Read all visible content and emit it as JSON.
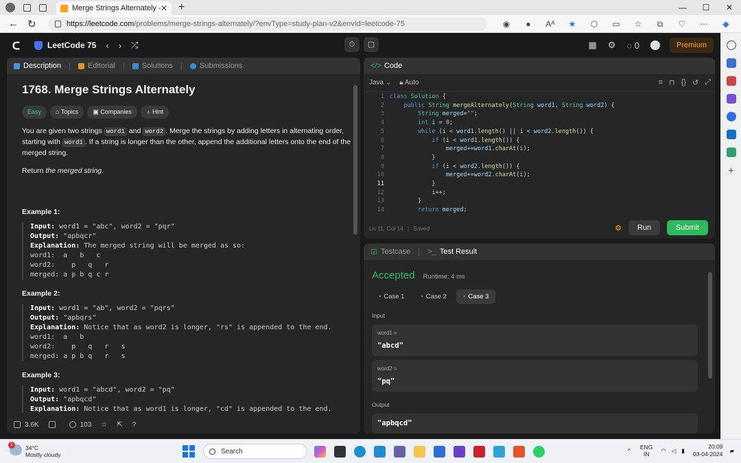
{
  "browser": {
    "tab_title": "Merge Strings Alternately - LeetC",
    "url_domain": "https://leetcode.com",
    "url_path": "/problems/merge-strings-alternately/?envType=study-plan-v2&envId=leetcode-75",
    "read_aloud": "Aᴬ"
  },
  "lc": {
    "plan": "LeetCode 75",
    "fire_count": "0",
    "premium": "Premium"
  },
  "desc": {
    "tabs": [
      "Description",
      "Editorial",
      "Solutions",
      "Submissions"
    ],
    "title": "1768. Merge Strings Alternately",
    "chips": [
      "Easy",
      "Topics",
      "Companies",
      "Hint"
    ],
    "p1_a": "You are given two strings ",
    "p1_w1": "word1",
    "p1_b": " and ",
    "p1_w2": "word2",
    "p1_c": ". Merge the strings by adding letters in alternating order, starting with ",
    "p1_w3": "word1",
    "p1_d": ". If a string is longer than the other, append the additional letters onto the end of the merged string.",
    "p2_a": "Return ",
    "p2_b": "the merged string",
    "p2_c": ".",
    "examples": [
      {
        "h": "Example 1:",
        "input": "word1 = \"abc\", word2 = \"pqr\"",
        "output": "\"apbqcr\"",
        "expl": "The merged string will be merged as so:",
        "extra": "word1:  a   b   c\nword2:    p   q   r\nmerged: a p b q c r"
      },
      {
        "h": "Example 2:",
        "input": "word1 = \"ab\", word2 = \"pqrs\"",
        "output": "\"apbqrs\"",
        "expl": "Notice that as word2 is longer, \"rs\" is appended to the end.",
        "extra": "word1:  a   b\nword2:    p   q   r   s\nmerged: a p b q   r   s"
      },
      {
        "h": "Example 3:",
        "input": "word1 = \"abcd\", word2 = \"pq\"",
        "output": "\"apbqcd\"",
        "expl": "Notice that as word1 is longer, \"cd\" is appended to the end.",
        "extra": ""
      }
    ],
    "lbl_input": "Input:",
    "lbl_output": "Output:",
    "lbl_expl": "Explanation:",
    "likes": "3.6K",
    "comments": "103"
  },
  "code": {
    "tab": "Code",
    "lang": "Java",
    "mode": "Auto",
    "status_pos": "Ln 11, Col 14",
    "status_saved": "Saved",
    "run": "Run",
    "submit": "Submit"
  },
  "result": {
    "tabs": [
      "Testcase",
      "Test Result"
    ],
    "verdict": "Accepted",
    "runtime": "Runtime: 4 ms",
    "cases": [
      "Case 1",
      "Case 2",
      "Case 3"
    ],
    "input_label": "Input",
    "w1_label": "word1 =",
    "w1_val": "\"abcd\"",
    "w2_label": "word2 =",
    "w2_val": "\"pq\"",
    "output_label": "Output",
    "out_val": "\"apbqcd\""
  },
  "taskbar": {
    "temp": "34°C",
    "weather": "Mostly cloudy",
    "search": "Search",
    "lang1": "ENG",
    "lang2": "IN",
    "time": "20:09",
    "date": "03-04-2024",
    "badge": "1"
  },
  "colors": {
    "accent_green": "#2cbb5d",
    "premium": "#ffa116",
    "easy": "#46c6c2"
  }
}
